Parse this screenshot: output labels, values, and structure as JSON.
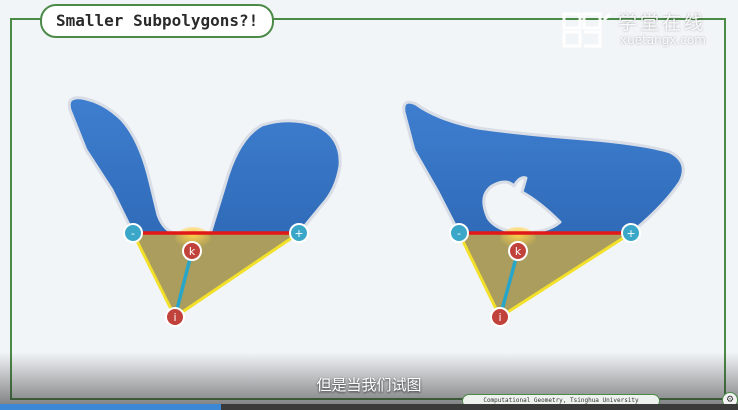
{
  "slide": {
    "title": "Smaller Subpolygons?!",
    "footer": "Computational Geometry, Tsinghua University"
  },
  "watermark": {
    "chinese": "学堂在线",
    "domain": "xuetangx.com"
  },
  "subtitle": "但是当我们试图",
  "figures": {
    "minus_label": "-",
    "plus_label": "+",
    "k_label": "k",
    "i_label": "i"
  },
  "player": {
    "progress": 0.3,
    "corner_icon": "settings-icon"
  },
  "colors": {
    "polygon": "#3b7cc9",
    "edge_red": "#e01818",
    "triangle_fill": "#9a8a3a",
    "triangle_edge": "#f2e02a",
    "link_cyan": "#27a6c9",
    "node_blue": "#3aa7c9",
    "node_red": "#c0423a",
    "frame_green": "#4c8a47"
  }
}
